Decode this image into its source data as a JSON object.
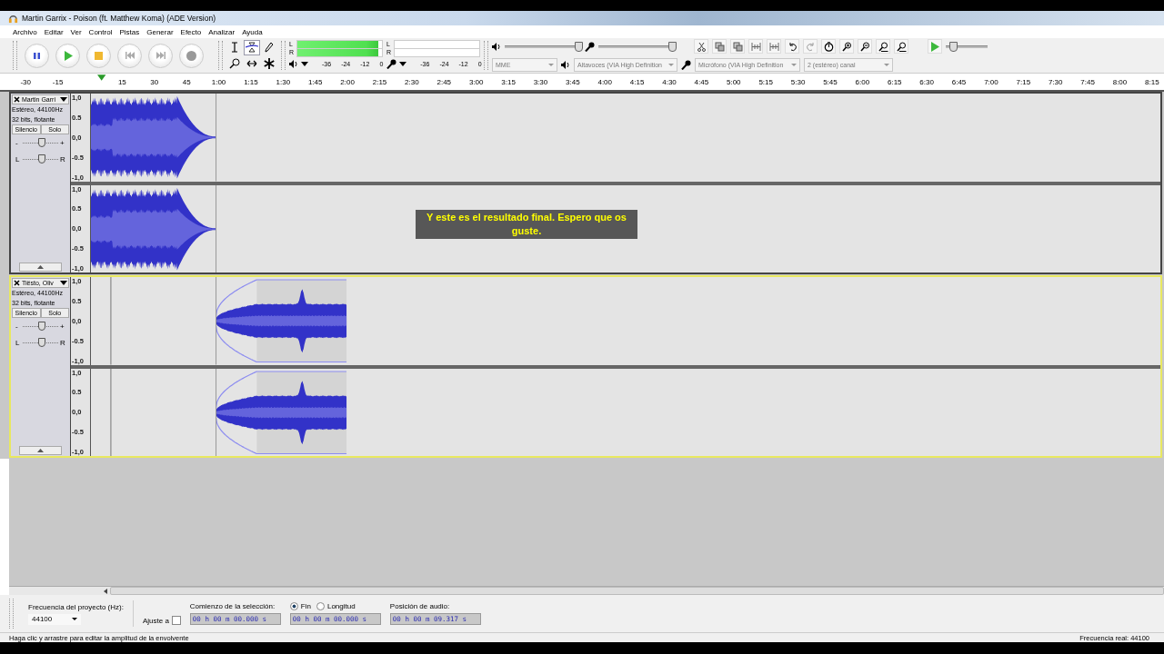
{
  "window": {
    "title": "Martin Garrix - Poison (ft. Matthew Koma) (ADE Version)"
  },
  "menu": [
    "Archivo",
    "Editar",
    "Ver",
    "Control",
    "Pistas",
    "Generar",
    "Efecto",
    "Analizar",
    "Ayuda"
  ],
  "tools": [
    {
      "selected": false
    },
    {
      "selected": true
    },
    {
      "selected": false
    },
    {
      "selected": false
    },
    {
      "selected": false
    },
    {
      "selected": false
    }
  ],
  "meters": [
    {
      "channels": [
        {
          "label": "L",
          "level": 0.96
        },
        {
          "label": "R",
          "level": 0.96
        }
      ],
      "scale": [
        "-36",
        "-24",
        "-12",
        "0"
      ]
    },
    {
      "channels": [
        {
          "label": "L"
        },
        {
          "label": "R"
        }
      ],
      "scale": [
        "-36",
        "-24",
        "-12",
        "0"
      ]
    }
  ],
  "mixer": {
    "playback_volume": {
      "level": 0.95
    },
    "recording_volume": {
      "level": 0.95
    }
  },
  "play_at_speed": {
    "level": 0.15
  },
  "devices": [
    {
      "value": "MME"
    },
    {
      "value": "Altavoces (VIA High Definition"
    },
    {
      "value": "Micrófono (VIA High Definition"
    },
    {
      "value": "2 (estéreo) canal"
    }
  ],
  "ruler": {
    "ticks": [
      "-30",
      "-15",
      "15",
      "30",
      "45",
      "1:00",
      "1:15",
      "1:30",
      "1:45",
      "2:00",
      "2:15",
      "2:30",
      "2:45",
      "3:00",
      "3:15",
      "3:30",
      "3:45",
      "4:00",
      "4:15",
      "4:30",
      "4:45",
      "5:00",
      "5:15",
      "5:30",
      "5:45",
      "6:00",
      "6:15",
      "6:30",
      "6:45",
      "7:00",
      "7:15",
      "7:30",
      "7:45",
      "8:00",
      "8:15"
    ]
  },
  "tracks": [
    {
      "name": "Martin Garri",
      "info": [
        "Estéreo, 44100Hz",
        "32 bits, flotante"
      ],
      "mute": "Silencio",
      "solo": "Solo",
      "gain": {
        "minus": "-",
        "plus": "+",
        "level": 0.5
      },
      "pan": {
        "left": "L",
        "right": "R",
        "level": 0.5
      },
      "selected": false,
      "channels": [
        {
          "scale": [
            "1,0",
            "0.5",
            "0,0",
            "-0.5",
            "-1,0"
          ]
        },
        {
          "scale": [
            "1,0",
            "0.5",
            "0,0",
            "-0.5",
            "-1,0"
          ]
        }
      ]
    },
    {
      "name": "Tiësto, Oliv",
      "info": [
        "Estéreo, 44100Hz",
        "32 bits, flotante"
      ],
      "mute": "Silencio",
      "solo": "Solo",
      "gain": {
        "minus": "-",
        "plus": "+",
        "level": 0.5
      },
      "pan": {
        "left": "L",
        "right": "R",
        "level": 0.5
      },
      "selected": true,
      "channels": [
        {
          "scale": [
            "1,0",
            "0.5",
            "0,0",
            "-0.5",
            "-1,0"
          ]
        },
        {
          "scale": [
            "1,0",
            "0.5",
            "0,0",
            "-0.5",
            "-1,0"
          ]
        }
      ]
    }
  ],
  "caption": "Y este es el resultado final. Espero que os guste.",
  "selection_bar": {
    "rate": {
      "label": "Frecuencia del proyecto (Hz):",
      "value": "44100"
    },
    "snap": {
      "label": "Ajuste a",
      "checked": false
    },
    "selection": {
      "label": "Comienzo de la selección:",
      "modes": [
        {
          "label": "Fin",
          "selected": true
        },
        {
          "label": "Longitud",
          "selected": false
        }
      ],
      "start": "00 h 00 m 00.000 s",
      "end": "00 h 00 m 00.000 s"
    },
    "position": {
      "label": "Posición de audio:",
      "value": "00 h 00 m 09.317 s"
    }
  },
  "status_bar": {
    "message": "Haga clic y arrastre para editar la amplitud de la envolvente",
    "rate": "Frecuencia real: 44100"
  }
}
